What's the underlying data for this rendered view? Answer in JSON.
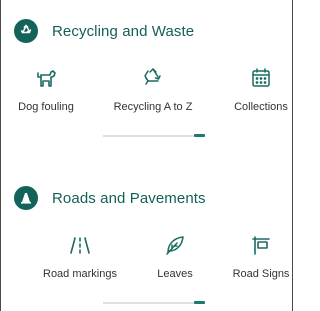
{
  "colors": {
    "accent": "#13635b",
    "title_text": "#145f57",
    "tile_text": "#333333",
    "icon_stroke": "#1a6b62",
    "scroll_track": "#e0e0e0",
    "scroll_thumb": "#1a7a6e"
  },
  "sections": [
    {
      "title": "Recycling and Waste",
      "badge_icon": "recycle-icon",
      "items": [
        {
          "label": "Dog fouling",
          "icon": "dog-icon"
        },
        {
          "label": "Recycling A to Z",
          "icon": "recycle-arrows-icon"
        },
        {
          "label": "Collections",
          "icon": "calendar-icon"
        }
      ]
    },
    {
      "title": "Roads and Pavements",
      "badge_icon": "cone-icon",
      "items": [
        {
          "label": "Road markings",
          "icon": "road-markings-icon"
        },
        {
          "label": "Leaves",
          "icon": "leaf-icon"
        },
        {
          "label": "Road Signs",
          "icon": "signpost-icon"
        }
      ]
    }
  ]
}
